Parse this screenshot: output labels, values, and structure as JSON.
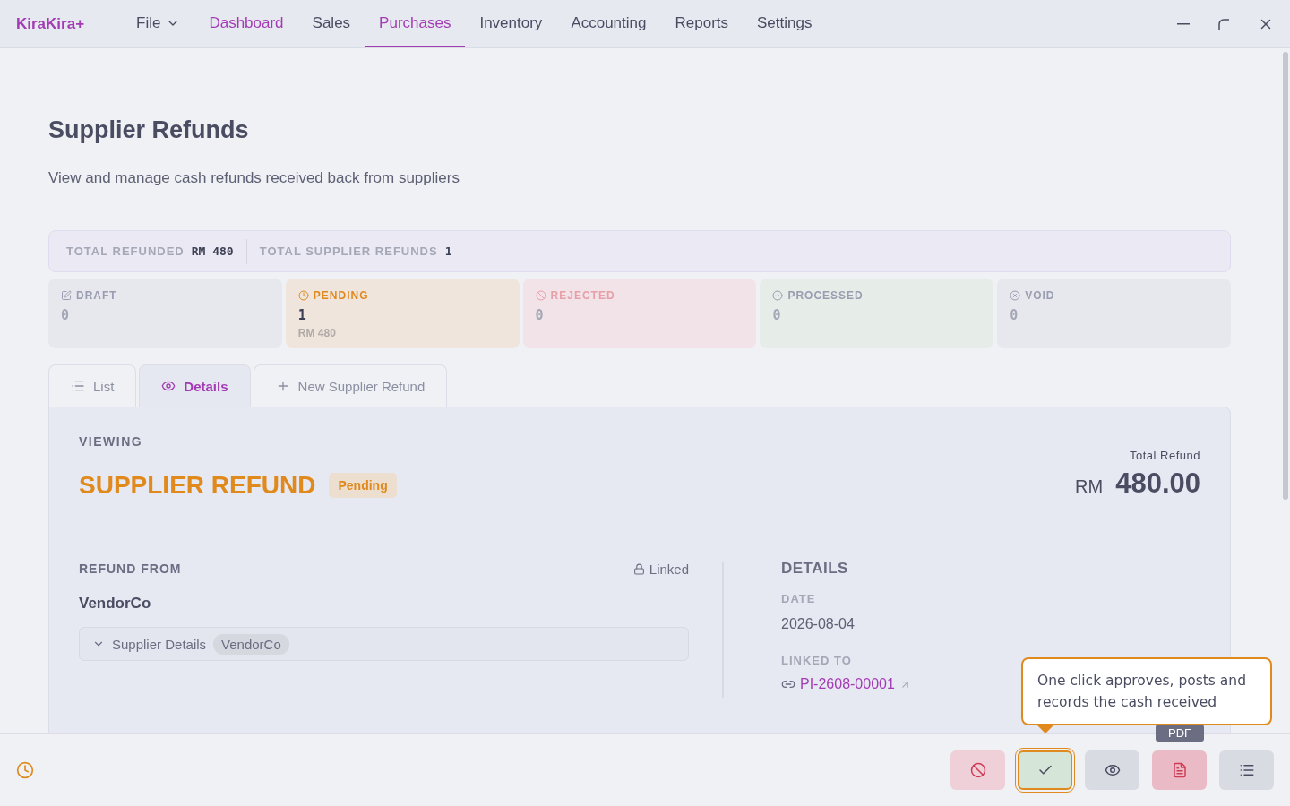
{
  "app": {
    "logo": "KiraKira+"
  },
  "menu": [
    {
      "label": "File",
      "kind": "dropdown",
      "selected": false,
      "highlighted": false
    },
    {
      "label": "Dashboard",
      "kind": "link",
      "selected": false,
      "highlighted": true
    },
    {
      "label": "Sales",
      "kind": "link",
      "selected": false,
      "highlighted": false
    },
    {
      "label": "Purchases",
      "kind": "link",
      "selected": true,
      "highlighted": false
    },
    {
      "label": "Inventory",
      "kind": "link",
      "selected": false,
      "highlighted": false
    },
    {
      "label": "Accounting",
      "kind": "link",
      "selected": false,
      "highlighted": false
    },
    {
      "label": "Reports",
      "kind": "link",
      "selected": false,
      "highlighted": false
    },
    {
      "label": "Settings",
      "kind": "link",
      "selected": false,
      "highlighted": false
    }
  ],
  "page": {
    "title": "Supplier Refunds",
    "subtitle": "View and manage cash refunds received back from suppliers"
  },
  "totals": [
    {
      "label": "TOTAL REFUNDED",
      "value": "RM 480"
    },
    {
      "label": "TOTAL SUPPLIER REFUNDS",
      "value": "1"
    }
  ],
  "statuses": [
    {
      "kind": "draft",
      "label": "DRAFT",
      "count": "0",
      "color": "#9a9db0"
    },
    {
      "kind": "pending",
      "label": "PENDING",
      "count": "1",
      "amount": "RM 480",
      "color": "#e08a1e"
    },
    {
      "kind": "rejected",
      "label": "REJECTED",
      "count": "0",
      "color": "#e8a0a8"
    },
    {
      "kind": "processed",
      "label": "PROCESSED",
      "count": "0",
      "color": "#9a9db0"
    },
    {
      "kind": "void",
      "label": "VOID",
      "count": "0",
      "color": "#9a9db0"
    }
  ],
  "tabs": [
    {
      "kind": "list",
      "label": "List",
      "selected": false
    },
    {
      "kind": "details",
      "label": "Details",
      "selected": true
    },
    {
      "kind": "new",
      "label": "New Supplier Refund",
      "selected": false
    }
  ],
  "detail": {
    "eyebrow": "VIEWING",
    "title": "SUPPLIER REFUND",
    "status": "Pending",
    "total_label": "Total Refund",
    "currency": "RM",
    "total": "480.00",
    "from_label": "REFUND FROM",
    "linked": "Linked",
    "supplier": "VendorCo",
    "supplier_details": {
      "label": "Supplier Details",
      "tag": "VendorCo",
      "expanded": false
    },
    "details_heading": "DETAILS",
    "date_label": "DATE",
    "date": "2026-08-04",
    "linked_label": "LINKED TO",
    "linked_doc": "PI-2608-00001"
  },
  "callout": "One click approves, posts and records the cash received",
  "tooltip": "PDF",
  "actions": [
    {
      "kind": "reject",
      "focused": false
    },
    {
      "kind": "approve",
      "focused": true
    },
    {
      "kind": "preview",
      "focused": false
    },
    {
      "kind": "pdf",
      "focused": false
    },
    {
      "kind": "list",
      "focused": false
    }
  ]
}
